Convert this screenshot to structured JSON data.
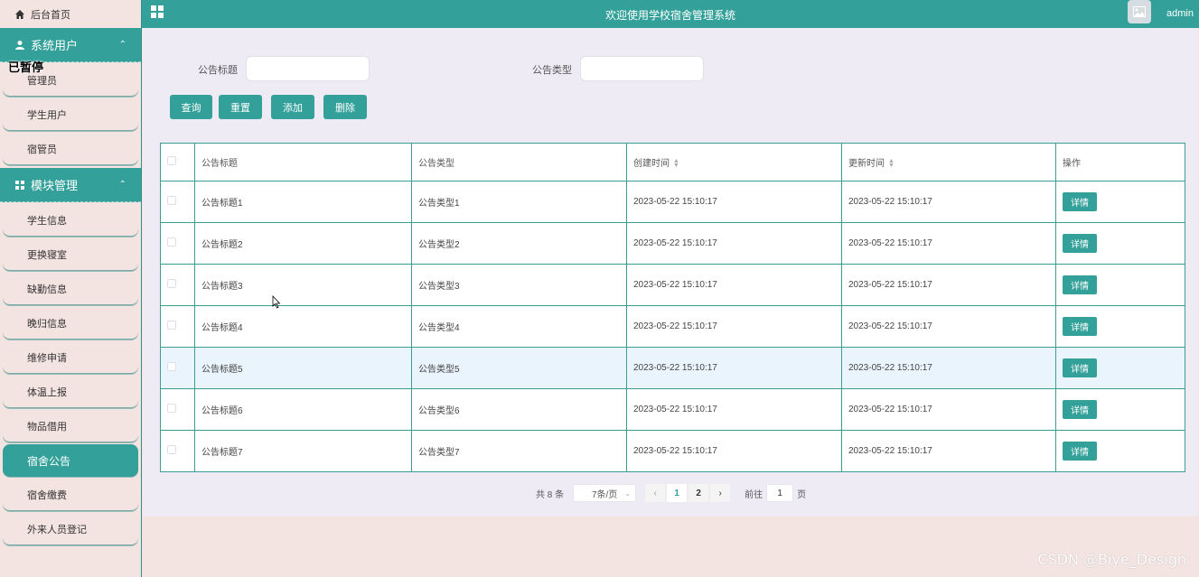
{
  "header": {
    "title": "欢迎使用学校宿舍管理系统",
    "username": "admin"
  },
  "sidebar": {
    "home": "后台首页",
    "paused_tag": "已暂停",
    "groups": [
      {
        "label": "系统用户",
        "items": [
          "管理员",
          "学生用户",
          "宿管员"
        ]
      },
      {
        "label": "模块管理",
        "items": [
          "学生信息",
          "更换寝室",
          "缺勤信息",
          "晚归信息",
          "维修申请",
          "体温上报",
          "物品借用",
          "宿舍公告",
          "宿舍缴费",
          "外来人员登记"
        ]
      }
    ],
    "active_item": "宿舍公告"
  },
  "filters": {
    "title_label": "公告标题",
    "title_value": "",
    "type_label": "公告类型",
    "type_value": ""
  },
  "actions": {
    "query": "查询",
    "reset": "重置",
    "add": "添加",
    "delete": "删除"
  },
  "table": {
    "columns": [
      "公告标题",
      "公告类型",
      "创建时间",
      "更新时间",
      "操作"
    ],
    "rows": [
      {
        "title": "公告标题1",
        "type": "公告类型1",
        "created": "2023-05-22 15:10:17",
        "updated": "2023-05-22 15:10:17",
        "action": "详情"
      },
      {
        "title": "公告标题2",
        "type": "公告类型2",
        "created": "2023-05-22 15:10:17",
        "updated": "2023-05-22 15:10:17",
        "action": "详情"
      },
      {
        "title": "公告标题3",
        "type": "公告类型3",
        "created": "2023-05-22 15:10:17",
        "updated": "2023-05-22 15:10:17",
        "action": "详情"
      },
      {
        "title": "公告标题4",
        "type": "公告类型4",
        "created": "2023-05-22 15:10:17",
        "updated": "2023-05-22 15:10:17",
        "action": "详情"
      },
      {
        "title": "公告标题5",
        "type": "公告类型5",
        "created": "2023-05-22 15:10:17",
        "updated": "2023-05-22 15:10:17",
        "action": "详情"
      },
      {
        "title": "公告标题6",
        "type": "公告类型6",
        "created": "2023-05-22 15:10:17",
        "updated": "2023-05-22 15:10:17",
        "action": "详情"
      },
      {
        "title": "公告标题7",
        "type": "公告类型7",
        "created": "2023-05-22 15:10:17",
        "updated": "2023-05-22 15:10:17",
        "action": "详情"
      }
    ]
  },
  "pagination": {
    "total": "共 8 条",
    "page_size": "7条/页",
    "pages": [
      "1",
      "2"
    ],
    "current": "1",
    "goto_prefix": "前往",
    "goto_value": "1",
    "goto_suffix": "页"
  },
  "watermark": "CSDN @Biye_Design",
  "colors": {
    "accent": "#33a09a",
    "sidebar_bg": "#f3e3e1",
    "main_bg": "#efebf5",
    "highlight_row": "#eaf4fd"
  },
  "icons": [
    "home-icon",
    "user-icon",
    "grid-icon",
    "chevron-up-icon",
    "image-icon",
    "sort-icon",
    "chevron-left-icon",
    "chevron-right-icon",
    "chevron-down-icon"
  ]
}
